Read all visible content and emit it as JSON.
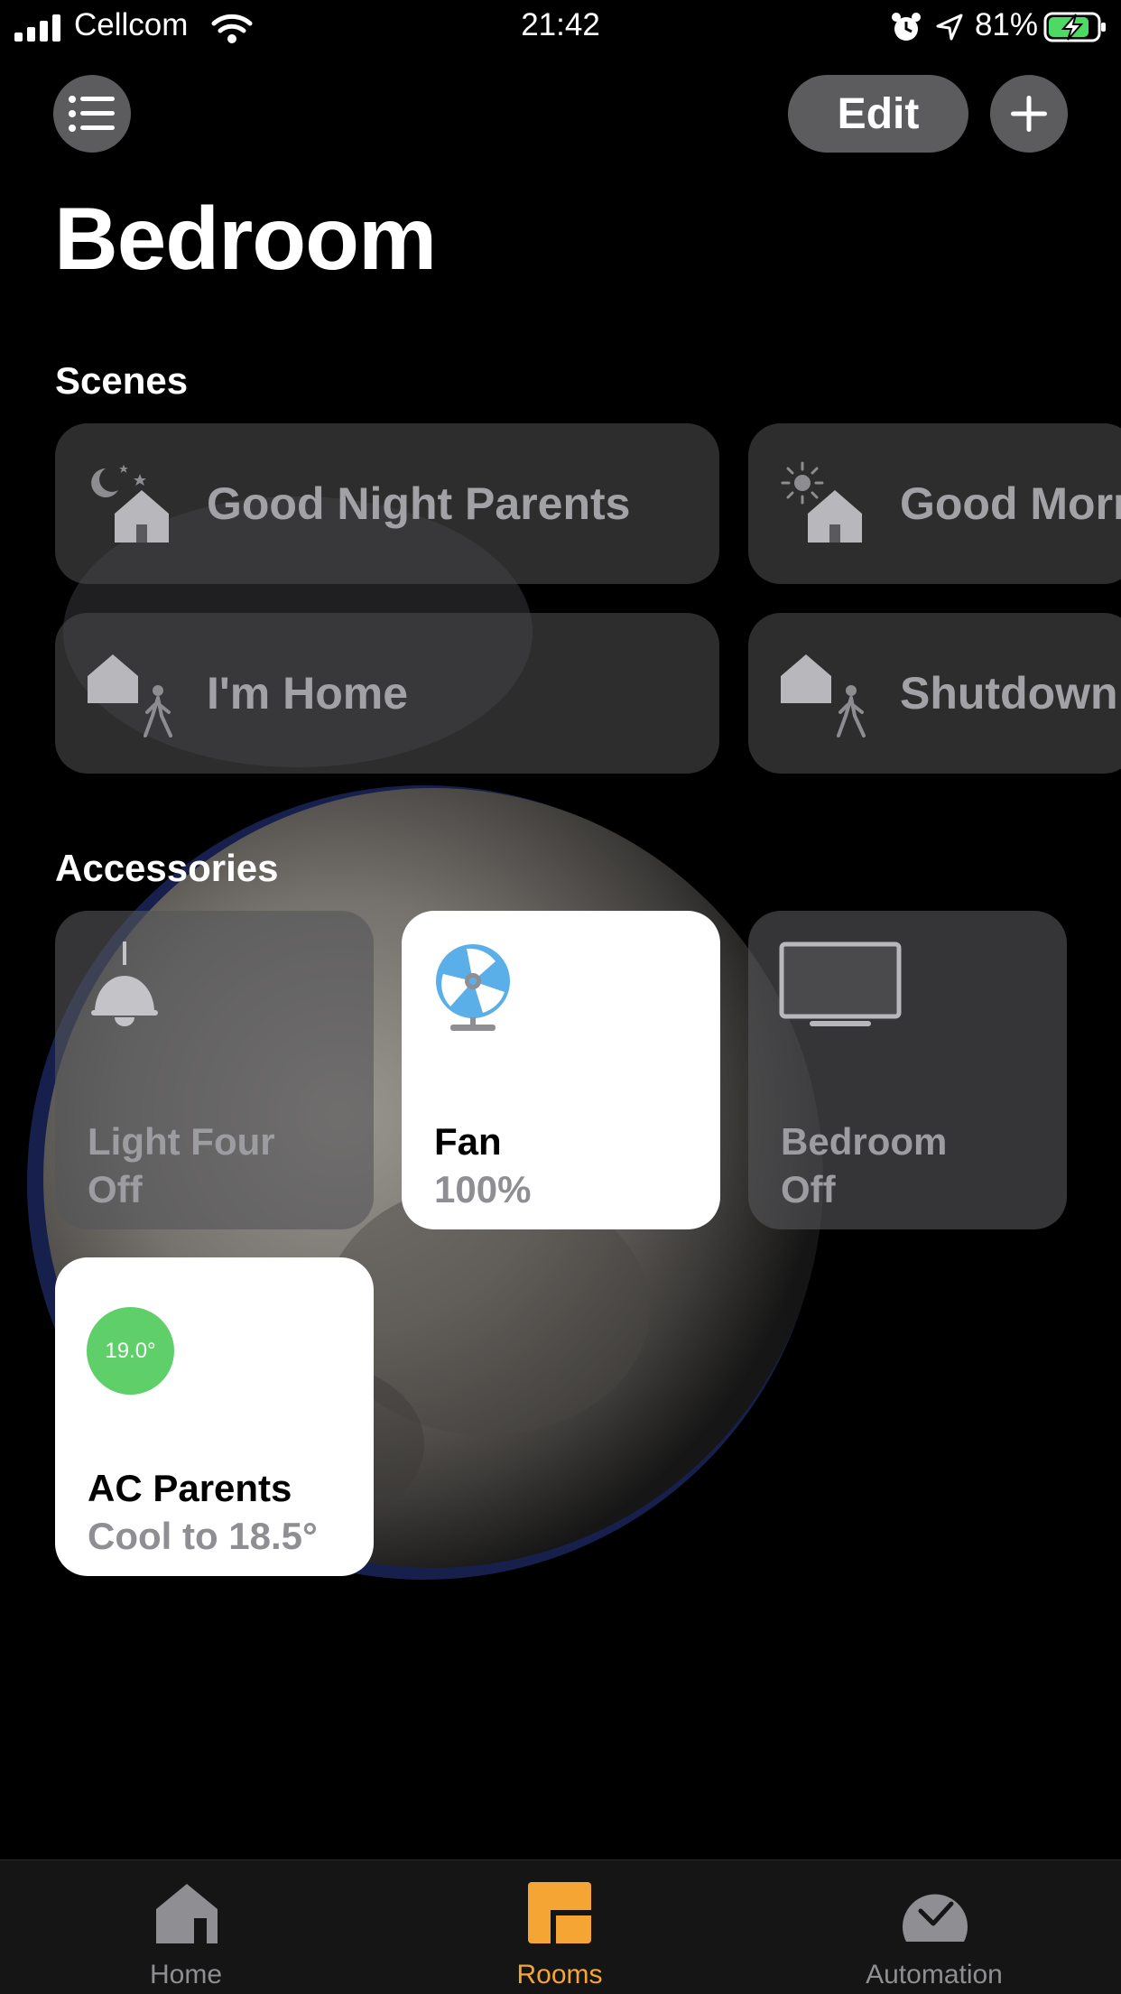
{
  "status_bar": {
    "carrier": "Cellcom",
    "time": "21:42",
    "battery_percent": "81%"
  },
  "header": {
    "edit_label": "Edit",
    "title": "Bedroom"
  },
  "scenes": {
    "heading": "Scenes",
    "items": [
      {
        "label": "Good Night Parents",
        "icon": "good-night-scene-icon"
      },
      {
        "label": "Good Morning",
        "icon": "good-morning-scene-icon"
      },
      {
        "label": "I'm Home",
        "icon": "arrive-home-scene-icon"
      },
      {
        "label": "Shutdown",
        "icon": "leave-home-scene-icon"
      }
    ]
  },
  "accessories": {
    "heading": "Accessories",
    "items": [
      {
        "name": "Light Four",
        "state": "Off",
        "icon": "pendant-lamp-icon",
        "on": false
      },
      {
        "name": "Fan",
        "state": "100%",
        "icon": "fan-icon",
        "on": true
      },
      {
        "name": "Bedroom",
        "state": "Off",
        "icon": "tv-icon",
        "on": false
      },
      {
        "name": "AC Parents",
        "state": "Cool to 18.5°",
        "current_temp": "19.0°",
        "icon": "thermostat-badge",
        "on": true
      }
    ]
  },
  "tabbar": {
    "items": [
      {
        "label": "Home",
        "icon": "home-icon",
        "active": false
      },
      {
        "label": "Rooms",
        "icon": "rooms-icon",
        "active": true
      },
      {
        "label": "Automation",
        "icon": "automation-icon",
        "active": false
      }
    ]
  },
  "colors": {
    "accent": "#f4a533",
    "tile_off": "#565658",
    "tile_on": "#ffffff",
    "thermostat_green": "#5fcf69",
    "fan_blue": "#5aafe8"
  }
}
